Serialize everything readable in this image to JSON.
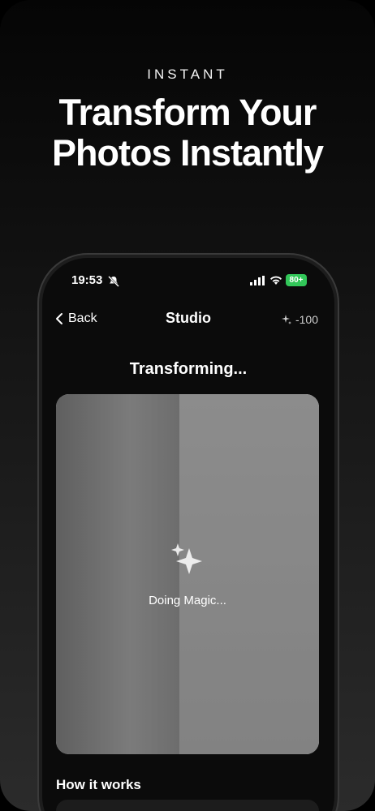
{
  "marketing": {
    "eyebrow": "INSTANT",
    "headline_line1": "Transform Your",
    "headline_line2": "Photos Instantly"
  },
  "status_bar": {
    "time": "19:53",
    "battery": "80+"
  },
  "nav": {
    "back_label": "Back",
    "title": "Studio",
    "credits": "-100"
  },
  "main": {
    "section_title": "Transforming...",
    "magic_text": "Doing Magic...",
    "how_it_works": "How it works"
  },
  "icons": {
    "bell": "bell-slash-icon",
    "signal": "signal-icon",
    "wifi": "wifi-icon",
    "back": "chevron-left-icon",
    "credits": "sparkle-icon",
    "magic": "sparkles-icon"
  },
  "colors": {
    "battery": "#32c759",
    "background": "#000000",
    "text": "#ffffff"
  }
}
